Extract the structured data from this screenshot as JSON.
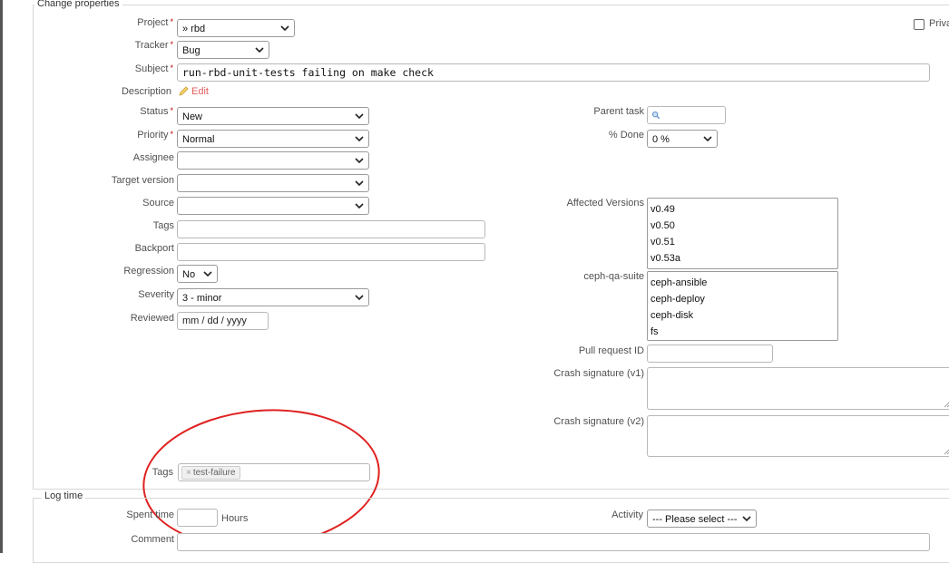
{
  "change_properties": {
    "legend": "Change properties",
    "private_label": "Priva",
    "project": {
      "label": "Project",
      "value": "» rbd"
    },
    "tracker": {
      "label": "Tracker",
      "value": "Bug"
    },
    "subject": {
      "label": "Subject",
      "value": "run-rbd-unit-tests failing on make check"
    },
    "description": {
      "label": "Description",
      "edit_label": "Edit"
    },
    "status": {
      "label": "Status",
      "value": "New"
    },
    "priority": {
      "label": "Priority",
      "value": "Normal"
    },
    "assignee": {
      "label": "Assignee",
      "value": ""
    },
    "target_version": {
      "label": "Target version",
      "value": ""
    },
    "source": {
      "label": "Source",
      "value": ""
    },
    "tags_text": {
      "label": "Tags",
      "value": ""
    },
    "backport": {
      "label": "Backport",
      "value": ""
    },
    "regression": {
      "label": "Regression",
      "value": "No"
    },
    "severity": {
      "label": "Severity",
      "value": "3 - minor"
    },
    "reviewed": {
      "label": "Reviewed",
      "placeholder": "mm / dd / yyyy"
    },
    "parent_task": {
      "label": "Parent task"
    },
    "done": {
      "label": "% Done",
      "value": "0 %"
    },
    "affected_versions": {
      "label": "Affected Versions",
      "options": [
        "v0.49",
        "v0.50",
        "v0.51",
        "v0.53a"
      ]
    },
    "ceph_qa_suite": {
      "label": "ceph-qa-suite",
      "options": [
        "ceph-ansible",
        "ceph-deploy",
        "ceph-disk",
        "fs"
      ]
    },
    "pull_request": {
      "label": "Pull request ID"
    },
    "crash_v1": {
      "label": "Crash signature (v1)"
    },
    "crash_v2": {
      "label": "Crash signature (v2)"
    },
    "tags": {
      "label": "Tags",
      "chip": "test-failure"
    }
  },
  "log_time": {
    "legend": "Log time",
    "spent_time": {
      "label": "Spent time",
      "unit": "Hours"
    },
    "activity": {
      "label": "Activity",
      "value": "--- Please select ---"
    },
    "comment": {
      "label": "Comment"
    }
  },
  "colors": {
    "required": "#bb0000",
    "edit_link": "#e35d5d",
    "highlight_circle": "#e02020"
  }
}
